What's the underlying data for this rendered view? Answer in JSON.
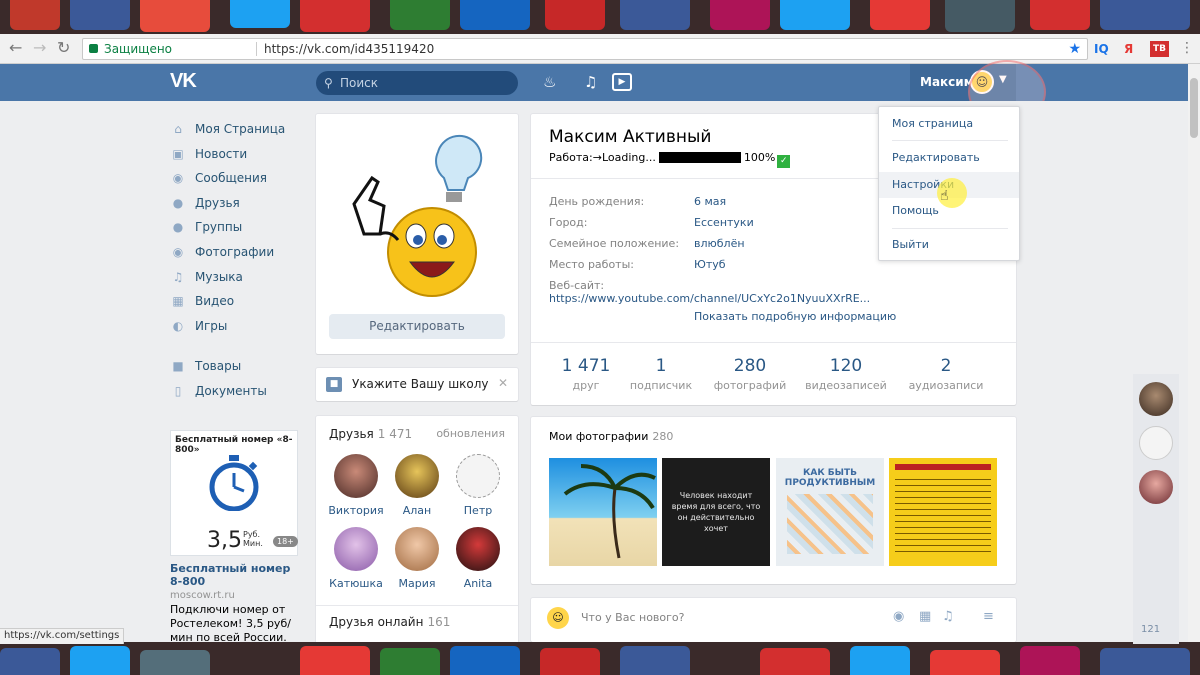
{
  "browser": {
    "secure_label": "Защищено",
    "url": "https://vk.com/id435119420",
    "ext_iq": "IQ",
    "ext_ya": "Я",
    "ext_tv": "ТВ",
    "status_url": "https://vk.com/settings"
  },
  "header": {
    "logo": "VK",
    "search_placeholder": "Поиск",
    "user_name": "Максим"
  },
  "menu": {
    "items": [
      {
        "label": "Моя Страница"
      },
      {
        "label": "Новости"
      },
      {
        "label": "Сообщения"
      },
      {
        "label": "Друзья"
      },
      {
        "label": "Группы"
      },
      {
        "label": "Фотографии"
      },
      {
        "label": "Музыка"
      },
      {
        "label": "Видео"
      },
      {
        "label": "Игры"
      },
      {
        "label": "Товары"
      },
      {
        "label": "Документы"
      }
    ]
  },
  "ad": {
    "box_title": "Бесплатный номер «8-800»",
    "price": "3,5",
    "price_unit": "Руб.",
    "price_per": "Мин.",
    "age": "18+",
    "title": "Бесплатный номер 8-800",
    "domain": "moscow.rt.ru",
    "text": "Подключи номер от Ростелеком! 3,5 руб/мин по всей России."
  },
  "profile": {
    "edit_button": "Редактировать",
    "school_prompt": "Укажите Вашу школу",
    "name": "Максим Активный",
    "status_prefix": "Работа:→Loading...",
    "status_percent": "100%",
    "fields": [
      {
        "key": "День рождения:",
        "value": "6 мая"
      },
      {
        "key": "Город:",
        "value": "Ессентуки"
      },
      {
        "key": "Семейное положение:",
        "value": "влюблён"
      },
      {
        "key": "Место работы:",
        "value": "Ютуб"
      },
      {
        "key": "Веб-сайт:",
        "value": "https://www.youtube.com/channel/UCxYc2o1NyuuXXrRE..."
      }
    ],
    "show_more": "Показать подробную информацию",
    "counters": [
      {
        "num": "1 471",
        "label": "друг"
      },
      {
        "num": "1",
        "label": "подписчик"
      },
      {
        "num": "280",
        "label": "фотографий"
      },
      {
        "num": "120",
        "label": "видеозаписей"
      },
      {
        "num": "2",
        "label": "аудиозаписи"
      }
    ]
  },
  "friends": {
    "title": "Друзья",
    "count": "1 471",
    "updates": "обновления",
    "people": [
      {
        "name": "Виктория"
      },
      {
        "name": "Алан"
      },
      {
        "name": "Петр"
      },
      {
        "name": "Катюшка"
      },
      {
        "name": "Мария"
      },
      {
        "name": "Anita"
      }
    ],
    "online_title": "Друзья онлайн",
    "online_count": "161"
  },
  "photos": {
    "title": "Мои фотографии",
    "count": "280",
    "pic2_caption": "Человек находит время для всего, что он действительно хочет",
    "pic3_caption": "КАК БЫТЬ ПРОДУКТИВНЫМ"
  },
  "post": {
    "placeholder": "Что у Вас нового?"
  },
  "dropdown": {
    "items": [
      {
        "label": "Моя страница"
      },
      {
        "label": "Редактировать"
      },
      {
        "label": "Настройки"
      },
      {
        "label": "Помощь"
      },
      {
        "label": "Выйти"
      }
    ]
  },
  "sidebar_right": {
    "count": "121"
  },
  "colors": {
    "vk_blue": "#4a76a8",
    "link": "#2a5885",
    "page_bg": "#edeef0"
  }
}
